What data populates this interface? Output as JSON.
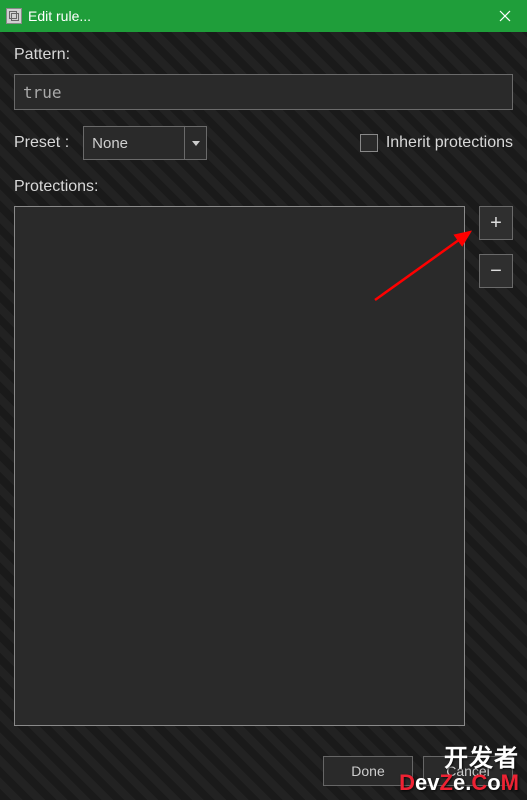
{
  "window": {
    "title": "Edit rule..."
  },
  "labels": {
    "pattern": "Pattern:",
    "preset": "Preset :",
    "inherit": "Inherit protections",
    "protections": "Protections:"
  },
  "fields": {
    "pattern_value": "true",
    "preset_selected": "None",
    "inherit_checked": false
  },
  "buttons": {
    "add": "+",
    "remove": "−",
    "done": "Done",
    "cancel": "Cancel"
  },
  "protections_list": [],
  "watermark": {
    "line1": "开发者",
    "line2_a": "D",
    "line2_b": "ev",
    "line2_c": "Z",
    "line2_d": "e.",
    "line2_e": "C",
    "line2_f": "o",
    "line2_g": "M"
  },
  "colors": {
    "titlebar_bg": "#1f9e3a",
    "arrow": "#ff0000"
  }
}
